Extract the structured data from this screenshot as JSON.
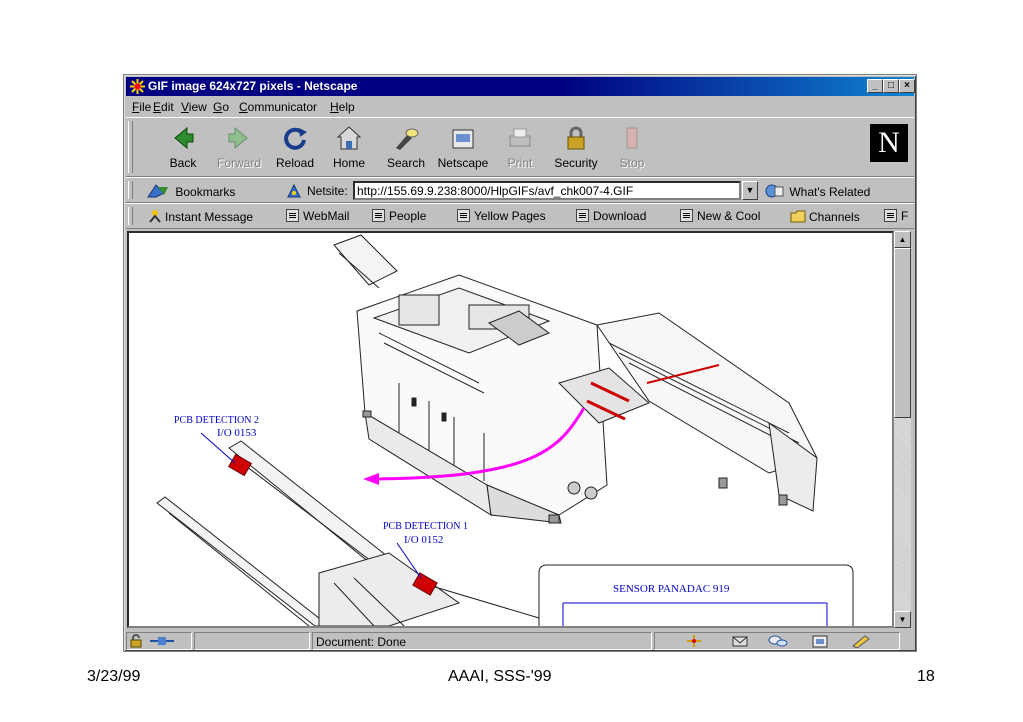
{
  "window": {
    "title": "GIF image 624x727 pixels - Netscape"
  },
  "menu": [
    "File",
    "Edit",
    "View",
    "Go",
    "Communicator",
    "Help"
  ],
  "nav": {
    "back": "Back",
    "forward": "Forward",
    "reload": "Reload",
    "home": "Home",
    "search": "Search",
    "netscape": "Netscape",
    "print": "Print",
    "security": "Security",
    "stop": "Stop",
    "logo": "N"
  },
  "location": {
    "bookmarks": "Bookmarks",
    "netsite_label": "Netsite:",
    "url": "http://155.69.9.238:8000/HlpGIFs/avf_chk007-4.GIF",
    "whats_related": "What's Related"
  },
  "personal": [
    "Instant Message",
    "WebMail",
    "People",
    "Yellow Pages",
    "Download",
    "New & Cool",
    "Channels",
    "F"
  ],
  "image": {
    "pcb2_title": "PCB DETECTION 2",
    "pcb2_io": "I/O  0153",
    "pcb1_title": "PCB DETECTION 1",
    "pcb1_io": "I/O  0152",
    "sensor": "SENSOR PANADAC 919"
  },
  "status": {
    "text": "Document: Done"
  },
  "footer": {
    "date": "3/23/99",
    "center": "AAAI, SSS-'99",
    "page": "18"
  }
}
